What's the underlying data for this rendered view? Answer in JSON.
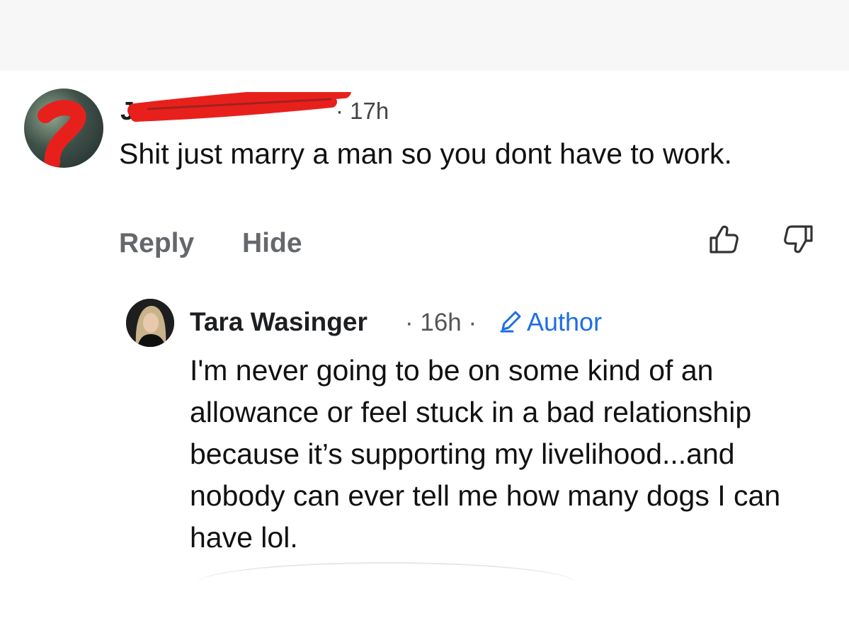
{
  "comments": [
    {
      "author": "J",
      "author_redacted": true,
      "time": "· 17h",
      "text": "Shit just marry a man so you dont have to work.",
      "actions": {
        "reply": "Reply",
        "hide": "Hide"
      }
    }
  ],
  "reply": {
    "author": "Tara Wasinger",
    "time": "· 16h ·",
    "badge": "Author",
    "text": "I'm never going to be on some kind of an allowance or feel stuck in a bad relationship because it’s supporting my livelihood...and nobody can ever tell me how many dogs I can have lol."
  },
  "colors": {
    "redaction": "#e8201c",
    "author_badge": "#1d6ee6",
    "action_text": "#65676b"
  },
  "icons": {
    "like": "thumbs-up-outline",
    "dislike": "thumbs-down-outline",
    "author_badge": "pencil"
  }
}
